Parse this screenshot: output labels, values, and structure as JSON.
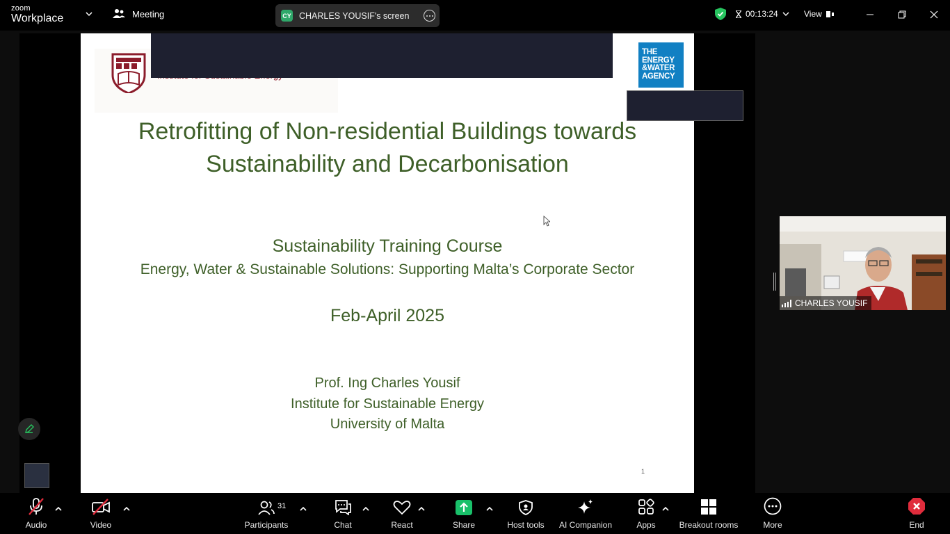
{
  "topbar": {
    "brand_small": "zoom",
    "brand_big": "Workplace",
    "meeting_label": "Meeting",
    "share_initials": "CY",
    "share_label": "CHARLES YOUSIF's screen",
    "timer": "00:13:24",
    "view_label": "View"
  },
  "slide": {
    "institute": "Institute for Sustainable Energy",
    "ewa_logo": [
      "THE",
      "ENERGY",
      "&WATER",
      "AGENCY"
    ],
    "title_line1": "Retrofitting of Non-residential Buildings towards",
    "title_line2": "Sustainability and Decarbonisation",
    "course_title": "Sustainability Training Course",
    "course_subtitle": "Energy, Water & Sustainable Solutions: Supporting Malta’s Corporate Sector",
    "dates": "Feb-April 2025",
    "author_line1": "Prof. Ing Charles Yousif",
    "author_line2": "Institute for Sustainable Energy",
    "author_line3": "University of Malta",
    "page_number": "1"
  },
  "video": {
    "participant_name": "CHARLES YOUSIF"
  },
  "toolbar": {
    "audio": "Audio",
    "video": "Video",
    "participants": "Participants",
    "participant_count": "31",
    "chat": "Chat",
    "react": "React",
    "share": "Share",
    "host_tools": "Host tools",
    "ai_companion": "AI Companion",
    "apps": "Apps",
    "breakout_rooms": "Breakout rooms",
    "more": "More",
    "end": "End"
  },
  "colors": {
    "slide_green": "#3e5f28",
    "institute_red": "#8b1c2b",
    "ewa_blue": "#1180c3",
    "share_green": "#19c06a",
    "end_red": "#e02c3c",
    "secure_green": "#27c45f"
  }
}
